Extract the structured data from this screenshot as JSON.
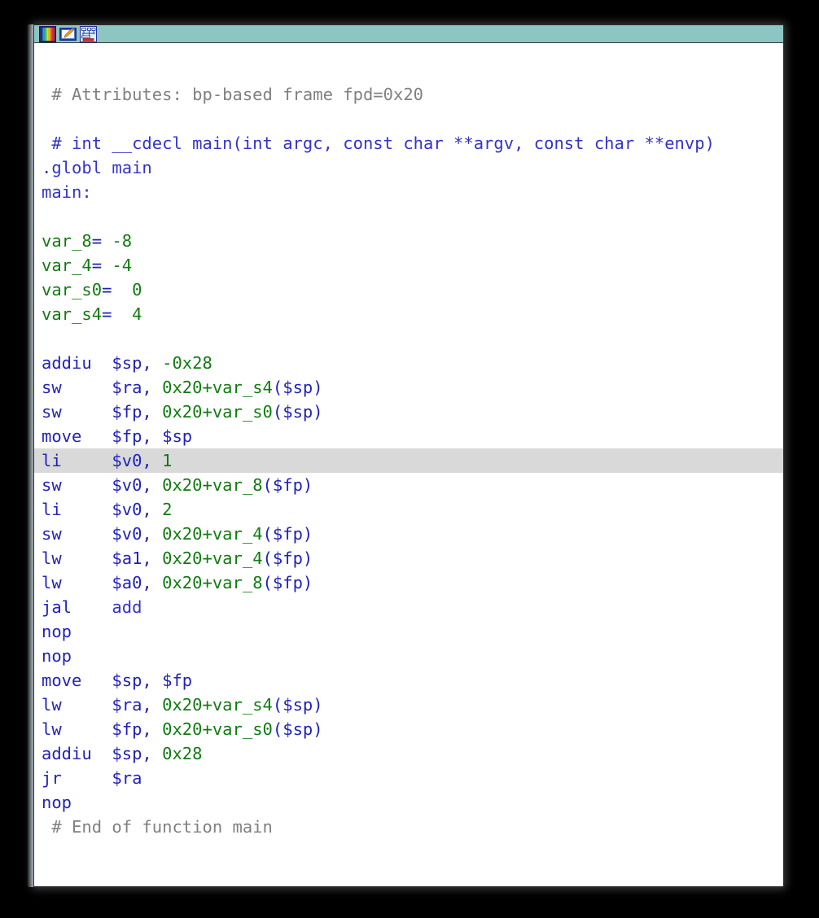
{
  "window": {
    "title": "",
    "background_color": "#ffffff",
    "border_color": "#2f2f2f"
  },
  "toolbar": {
    "background_color": "#8dc5c3",
    "buttons": [
      {
        "name": "color-palette-icon",
        "tooltip": "Colors"
      },
      {
        "name": "pencil-edit-icon",
        "tooltip": "Edit"
      },
      {
        "name": "graph-chart-icon",
        "tooltip": "Graph view"
      }
    ]
  },
  "colors": {
    "comment_gray": "#808080",
    "comment_blue": "#3333cc",
    "mnemonic_blue": "#2222bb",
    "register_blue": "#2222bb",
    "number_green": "#107c10",
    "variable_green": "#107c10",
    "highlight_row": "#d9d9d9",
    "toolbar_teal": "#8dc5c3"
  },
  "disassembly": {
    "highlighted_line_index": 15,
    "lines": [
      {
        "kind": "comment-gray",
        "indent": 1,
        "tokens": [
          {
            "c": "tok-comment",
            "t": "# Attributes: bp-based frame fpd=0x20"
          }
        ]
      },
      {
        "kind": "blank",
        "tokens": [
          {
            "c": "tok-comment",
            "t": " "
          }
        ]
      },
      {
        "kind": "comment-blue",
        "indent": 1,
        "tokens": [
          {
            "c": "tok-cmt-blue",
            "t": "# int __cdecl main(int argc, const char **argv, const char **envp)"
          }
        ]
      },
      {
        "kind": "directive",
        "tokens": [
          {
            "c": "tok-directive",
            "t": ".globl main"
          }
        ]
      },
      {
        "kind": "label",
        "tokens": [
          {
            "c": "tok-label",
            "t": "main:"
          }
        ]
      },
      {
        "kind": "blank",
        "tokens": [
          {
            "c": "tok-comment",
            "t": " "
          }
        ]
      },
      {
        "kind": "vardef",
        "tokens": [
          {
            "c": "tok-var",
            "t": "var_8"
          },
          {
            "c": "tok-eq",
            "t": "="
          },
          {
            "c": "tok-num",
            "t": " -8"
          }
        ]
      },
      {
        "kind": "vardef",
        "tokens": [
          {
            "c": "tok-var",
            "t": "var_4"
          },
          {
            "c": "tok-eq",
            "t": "="
          },
          {
            "c": "tok-num",
            "t": " -4"
          }
        ]
      },
      {
        "kind": "vardef",
        "tokens": [
          {
            "c": "tok-var",
            "t": "var_s0"
          },
          {
            "c": "tok-eq",
            "t": "="
          },
          {
            "c": "tok-num",
            "t": "  0"
          }
        ]
      },
      {
        "kind": "vardef",
        "tokens": [
          {
            "c": "tok-var",
            "t": "var_s4"
          },
          {
            "c": "tok-eq",
            "t": "="
          },
          {
            "c": "tok-num",
            "t": "  4"
          }
        ]
      },
      {
        "kind": "blank",
        "tokens": [
          {
            "c": "tok-comment",
            "t": " "
          }
        ]
      },
      {
        "kind": "insn",
        "tokens": [
          {
            "c": "tok-mnem",
            "t": "addiu  "
          },
          {
            "c": "tok-reg",
            "t": "$sp, "
          },
          {
            "c": "tok-num",
            "t": "-0x28"
          }
        ]
      },
      {
        "kind": "insn",
        "tokens": [
          {
            "c": "tok-mnem",
            "t": "sw     "
          },
          {
            "c": "tok-reg",
            "t": "$ra, "
          },
          {
            "c": "tok-num",
            "t": "0x20+var_s4"
          },
          {
            "c": "tok-reg",
            "t": "($sp)"
          }
        ]
      },
      {
        "kind": "insn",
        "tokens": [
          {
            "c": "tok-mnem",
            "t": "sw     "
          },
          {
            "c": "tok-reg",
            "t": "$fp, "
          },
          {
            "c": "tok-num",
            "t": "0x20+var_s0"
          },
          {
            "c": "tok-reg",
            "t": "($sp)"
          }
        ]
      },
      {
        "kind": "insn",
        "tokens": [
          {
            "c": "tok-mnem",
            "t": "move   "
          },
          {
            "c": "tok-reg",
            "t": "$fp, $sp"
          }
        ]
      },
      {
        "kind": "insn",
        "tokens": [
          {
            "c": "tok-mnem",
            "t": "li     "
          },
          {
            "c": "tok-reg",
            "t": "$v0, "
          },
          {
            "c": "tok-num",
            "t": "1"
          }
        ]
      },
      {
        "kind": "insn",
        "tokens": [
          {
            "c": "tok-mnem",
            "t": "sw     "
          },
          {
            "c": "tok-reg",
            "t": "$v0, "
          },
          {
            "c": "tok-num",
            "t": "0x20+var_8"
          },
          {
            "c": "tok-reg",
            "t": "($fp)"
          }
        ]
      },
      {
        "kind": "insn",
        "tokens": [
          {
            "c": "tok-mnem",
            "t": "li     "
          },
          {
            "c": "tok-reg",
            "t": "$v0, "
          },
          {
            "c": "tok-num",
            "t": "2"
          }
        ]
      },
      {
        "kind": "insn",
        "tokens": [
          {
            "c": "tok-mnem",
            "t": "sw     "
          },
          {
            "c": "tok-reg",
            "t": "$v0, "
          },
          {
            "c": "tok-num",
            "t": "0x20+var_4"
          },
          {
            "c": "tok-reg",
            "t": "($fp)"
          }
        ]
      },
      {
        "kind": "insn",
        "tokens": [
          {
            "c": "tok-mnem",
            "t": "lw     "
          },
          {
            "c": "tok-reg",
            "t": "$a1, "
          },
          {
            "c": "tok-num",
            "t": "0x20+var_4"
          },
          {
            "c": "tok-reg",
            "t": "($fp)"
          }
        ]
      },
      {
        "kind": "insn",
        "tokens": [
          {
            "c": "tok-mnem",
            "t": "lw     "
          },
          {
            "c": "tok-reg",
            "t": "$a0, "
          },
          {
            "c": "tok-num",
            "t": "0x20+var_8"
          },
          {
            "c": "tok-reg",
            "t": "($fp)"
          }
        ]
      },
      {
        "kind": "insn",
        "tokens": [
          {
            "c": "tok-mnem",
            "t": "jal    "
          },
          {
            "c": "tok-func",
            "t": "add"
          }
        ]
      },
      {
        "kind": "insn",
        "tokens": [
          {
            "c": "tok-mnem",
            "t": "nop"
          }
        ]
      },
      {
        "kind": "insn",
        "tokens": [
          {
            "c": "tok-mnem",
            "t": "nop"
          }
        ]
      },
      {
        "kind": "insn",
        "tokens": [
          {
            "c": "tok-mnem",
            "t": "move   "
          },
          {
            "c": "tok-reg",
            "t": "$sp, $fp"
          }
        ]
      },
      {
        "kind": "insn",
        "tokens": [
          {
            "c": "tok-mnem",
            "t": "lw     "
          },
          {
            "c": "tok-reg",
            "t": "$ra, "
          },
          {
            "c": "tok-num",
            "t": "0x20+var_s4"
          },
          {
            "c": "tok-reg",
            "t": "($sp)"
          }
        ]
      },
      {
        "kind": "insn",
        "tokens": [
          {
            "c": "tok-mnem",
            "t": "lw     "
          },
          {
            "c": "tok-reg",
            "t": "$fp, "
          },
          {
            "c": "tok-num",
            "t": "0x20+var_s0"
          },
          {
            "c": "tok-reg",
            "t": "($sp)"
          }
        ]
      },
      {
        "kind": "insn",
        "tokens": [
          {
            "c": "tok-mnem",
            "t": "addiu  "
          },
          {
            "c": "tok-reg",
            "t": "$sp, "
          },
          {
            "c": "tok-num",
            "t": "0x28"
          }
        ]
      },
      {
        "kind": "insn",
        "tokens": [
          {
            "c": "tok-mnem",
            "t": "jr     "
          },
          {
            "c": "tok-reg",
            "t": "$ra"
          }
        ]
      },
      {
        "kind": "insn",
        "tokens": [
          {
            "c": "tok-mnem",
            "t": "nop"
          }
        ]
      },
      {
        "kind": "comment-gray",
        "indent": 1,
        "tokens": [
          {
            "c": "tok-comment",
            "t": "# End of function main"
          }
        ]
      }
    ]
  }
}
